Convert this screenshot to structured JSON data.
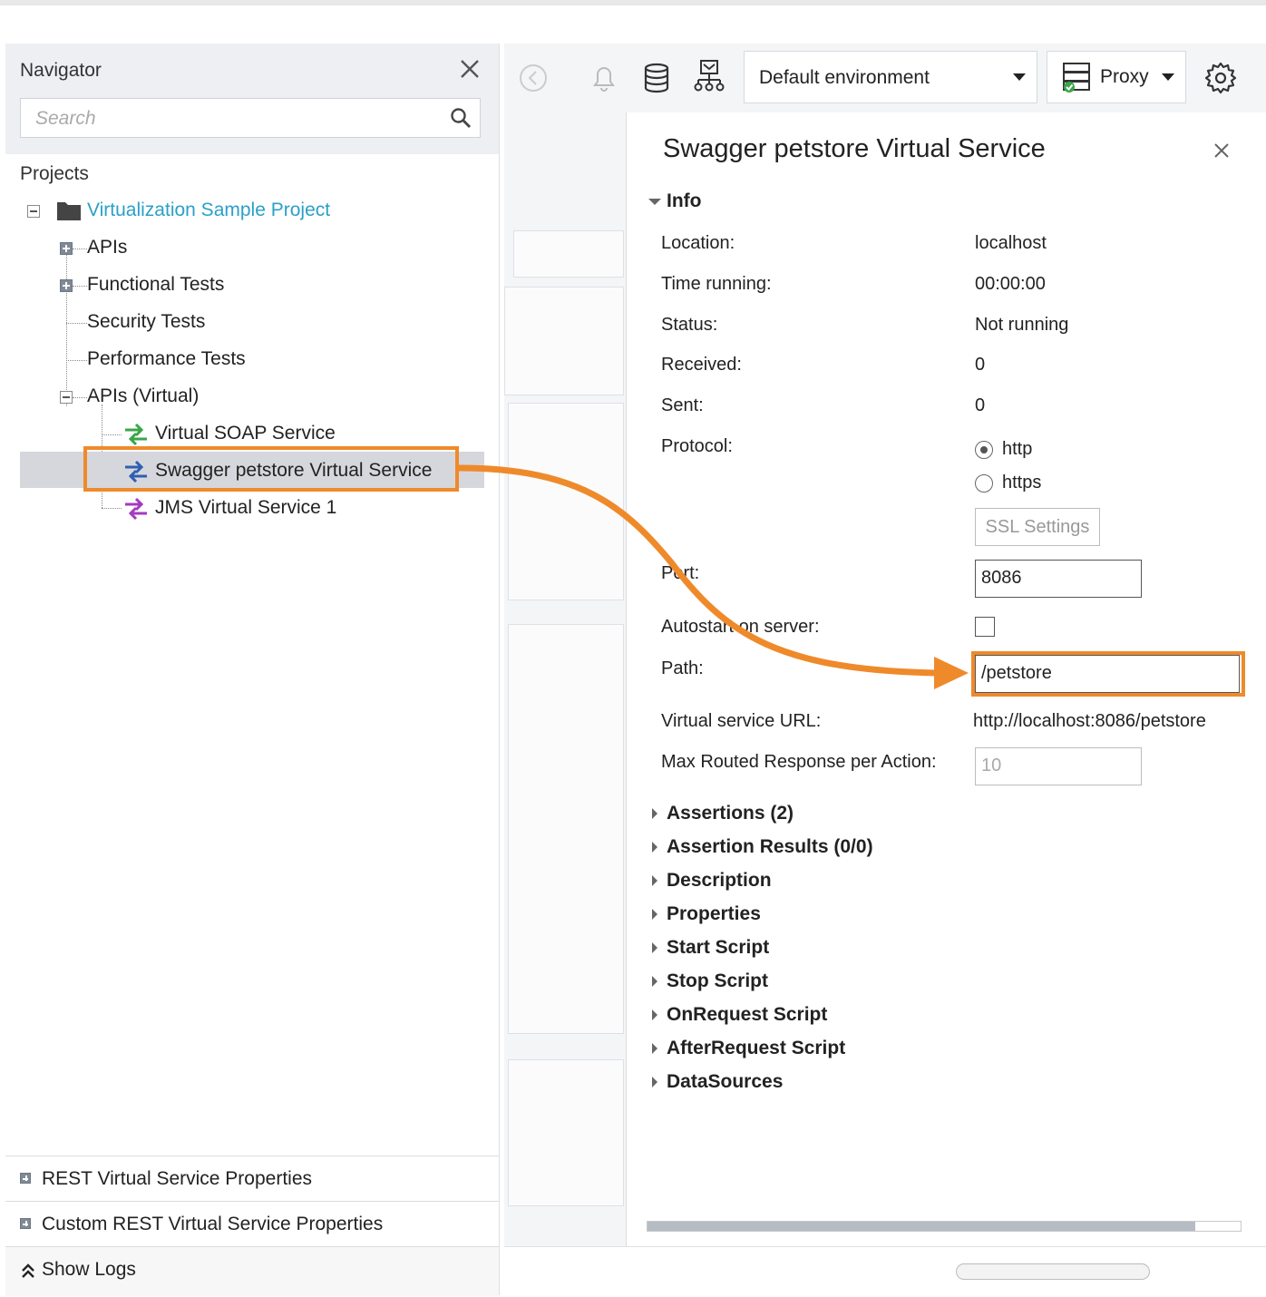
{
  "navigator": {
    "title": "Navigator",
    "search_placeholder": "Search",
    "projects_label": "Projects",
    "tree": {
      "project": "Virtualization Sample Project",
      "apis": "APIs",
      "functional_tests": "Functional Tests",
      "security_tests": "Security Tests",
      "performance_tests": "Performance Tests",
      "apis_virtual": "APIs (Virtual)",
      "virtual_soap": "Virtual SOAP Service",
      "swagger_service": "Swagger petstore Virtual Service",
      "jms_service": "JMS Virtual Service 1"
    },
    "footer": {
      "rest_props": "REST Virtual Service Properties",
      "custom_rest_props": "Custom REST Virtual Service Properties",
      "show_logs": "Show Logs"
    }
  },
  "toolbar": {
    "environment": "Default environment",
    "proxy": "Proxy"
  },
  "inspector": {
    "title": "Swagger petstore Virtual Service",
    "info_header": "Info",
    "labels": {
      "location": "Location:",
      "time_running": "Time running:",
      "status": "Status:",
      "received": "Received:",
      "sent": "Sent:",
      "protocol": "Protocol:",
      "port": "Port:",
      "autostart": "Autostart on server:",
      "path": "Path:",
      "virtual_url": "Virtual service URL:",
      "max_routed": "Max Routed Response per Action:"
    },
    "values": {
      "location": "localhost",
      "time_running": "00:00:00",
      "status": "Not running",
      "received": "0",
      "sent": "0",
      "protocol_http": "http",
      "protocol_https": "https",
      "ssl_settings": "SSL Settings",
      "port": "8086",
      "path": "/petstore",
      "virtual_url": "http://localhost:8086/petstore",
      "max_routed": "10"
    },
    "sections": [
      "Assertions (2)",
      "Assertion Results (0/0)",
      "Description",
      "Properties",
      "Start Script",
      "Stop Script",
      "OnRequest Script",
      "AfterRequest Script",
      "DataSources"
    ]
  },
  "colors": {
    "highlight": "#ef8a2b",
    "project_link": "#2aa0c8",
    "selection": "#d6d7dc"
  }
}
